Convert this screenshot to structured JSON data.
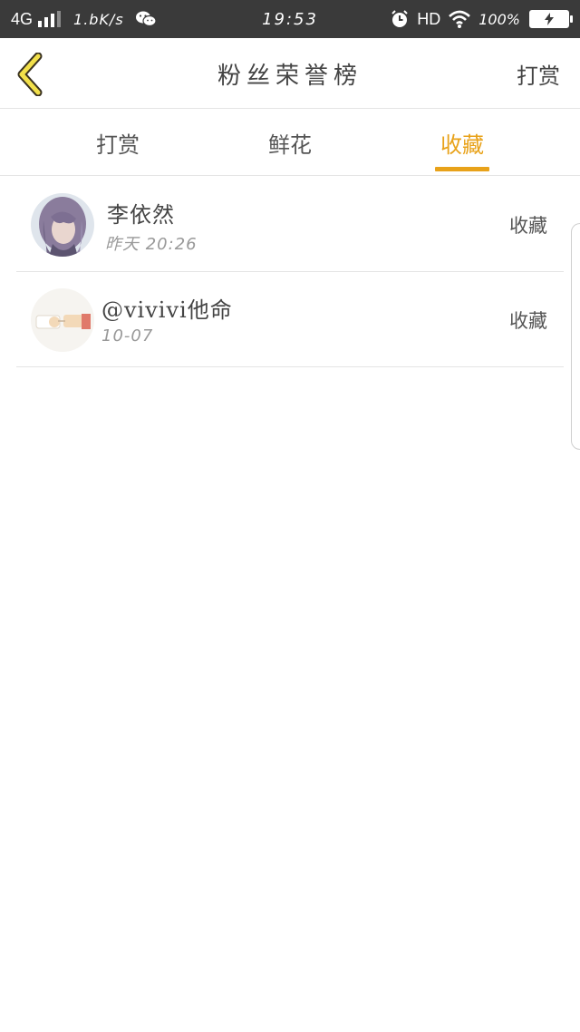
{
  "status_bar": {
    "network": "4G",
    "speed": "1.bK/s",
    "time": "19:53",
    "hd": "HD",
    "battery_pct": "100%",
    "battery_level": 1.0
  },
  "header": {
    "title": "粉丝荣誉榜",
    "action_label": "打赏"
  },
  "tabs": {
    "items": [
      {
        "label": "打赏",
        "active": false
      },
      {
        "label": "鲜花",
        "active": false
      },
      {
        "label": "收藏",
        "active": true
      }
    ],
    "accent_color": "#e8a21a"
  },
  "list": {
    "rows": [
      {
        "name": "李依然",
        "date": "昨天 20:26",
        "action": "收藏"
      },
      {
        "name": "@vivivi他命",
        "date": "10-07",
        "action": "收藏"
      }
    ]
  }
}
